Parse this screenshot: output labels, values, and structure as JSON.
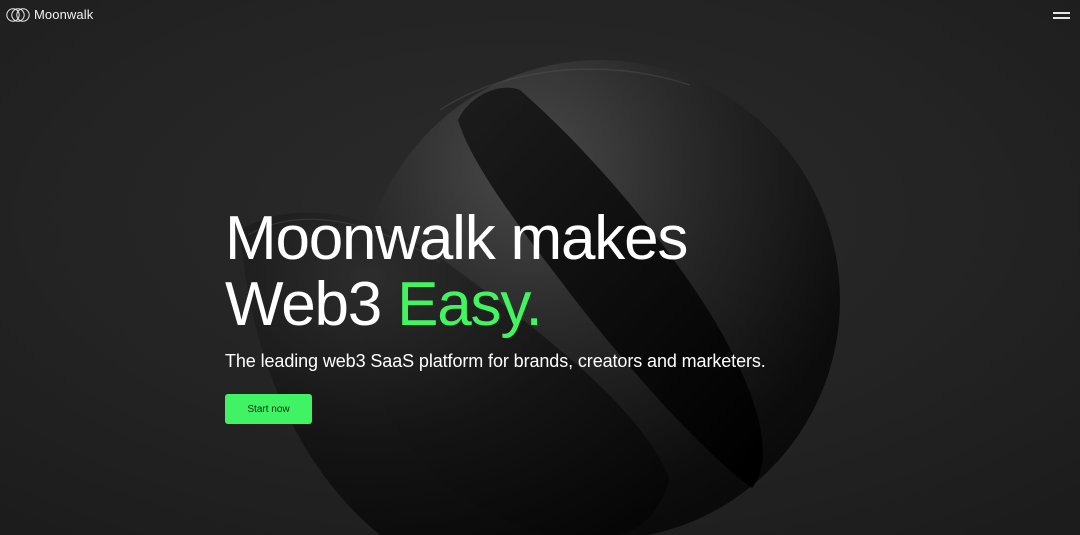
{
  "header": {
    "brand": "Moonwalk",
    "logo_icon": "interlocking-circles-logo",
    "menu_icon": "hamburger-menu-icon"
  },
  "hero": {
    "title_line1": "Moonwalk makes",
    "title_line2_prefix": "Web3 ",
    "title_line2_accent": "Easy.",
    "subtitle": "The leading web3 SaaS platform for brands, creators and marketers.",
    "cta_label": "Start now",
    "background_art": "split-sphere-illustration"
  },
  "colors": {
    "background": "#232323",
    "accent": "#42f560",
    "button_bg": "#3ff365",
    "button_text": "#0e2b12",
    "text": "#ffffff"
  }
}
